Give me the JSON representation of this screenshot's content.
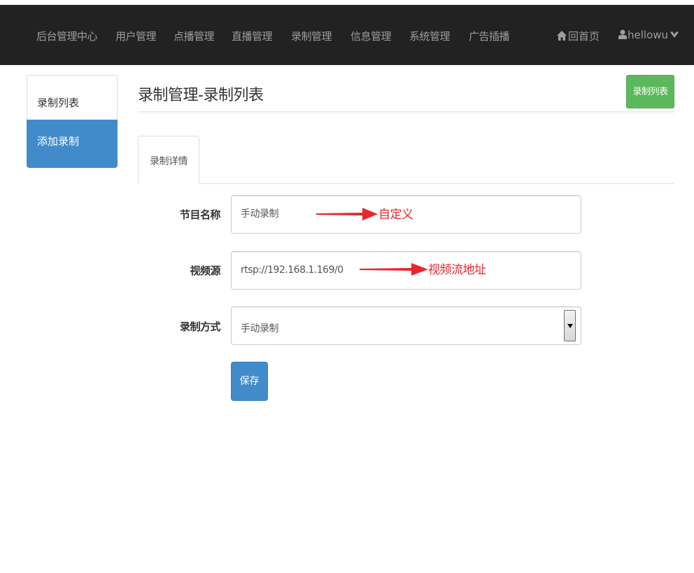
{
  "navbar": {
    "brand": "后台管理中心",
    "items": [
      "用户管理",
      "点播管理",
      "直播管理",
      "录制管理",
      "信息管理",
      "系统管理",
      "广告插播"
    ],
    "home_label": "回首页",
    "user_label": "hellowu"
  },
  "sidebar": {
    "items": [
      {
        "label": "录制列表"
      },
      {
        "label": "添加录制"
      }
    ]
  },
  "main": {
    "title": "录制管理-录制列表",
    "list_button": "录制列表",
    "tab_label": "录制详情"
  },
  "form": {
    "program_name": {
      "label": "节目名称",
      "value": "手动录制"
    },
    "video_source": {
      "label": "视频源",
      "value": "rtsp://192.168.1.169/0"
    },
    "record_mode": {
      "label": "录制方式",
      "value": "手动录制"
    },
    "save_label": "保存"
  },
  "annotations": {
    "custom": "自定义",
    "stream_address": "视频流地址"
  },
  "colors": {
    "navbar_bg": "#222222",
    "primary": "#428bca",
    "success": "#5cb85c",
    "annotation": "#e8262b"
  }
}
